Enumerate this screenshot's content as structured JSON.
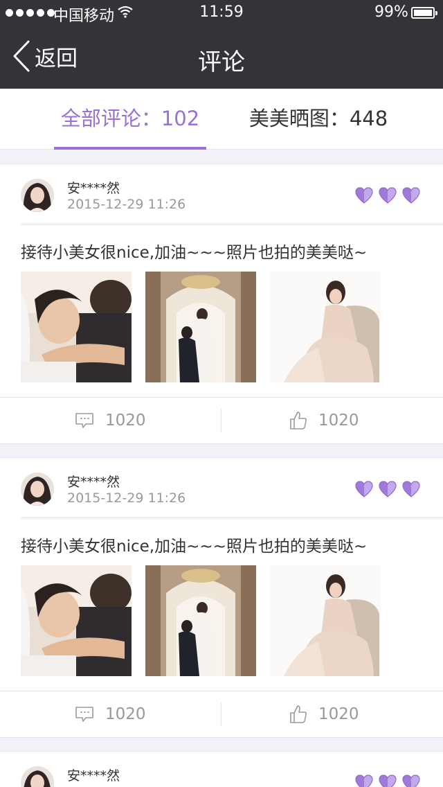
{
  "status_bar": {
    "carrier": "中国移动",
    "time": "11:59",
    "battery": "99%"
  },
  "nav": {
    "back_label": "返回",
    "title": "评论"
  },
  "tabs": [
    {
      "label": "全部评论：102",
      "active": true
    },
    {
      "label": "美美晒图：448",
      "active": false
    }
  ],
  "accent_color": "#9a6fd6",
  "comments": [
    {
      "user": "安****然",
      "date": "2015-12-29 11:26",
      "hearts": 3,
      "text": "接待小美女很nice,加油~~~照片也拍的美美哒~",
      "photos": [
        "wedding-photo-embrace",
        "wedding-photo-hall",
        "wedding-photo-sofa"
      ],
      "comment_count": "1020",
      "like_count": "1020"
    },
    {
      "user": "安****然",
      "date": "2015-12-29 11:26",
      "hearts": 3,
      "text": "接待小美女很nice,加油~~~照片也拍的美美哒~",
      "photos": [
        "wedding-photo-embrace",
        "wedding-photo-hall",
        "wedding-photo-sofa"
      ],
      "comment_count": "1020",
      "like_count": "1020"
    },
    {
      "user": "安****然",
      "date": "",
      "hearts": 3,
      "text": "",
      "photos": [],
      "comment_count": "",
      "like_count": ""
    }
  ]
}
